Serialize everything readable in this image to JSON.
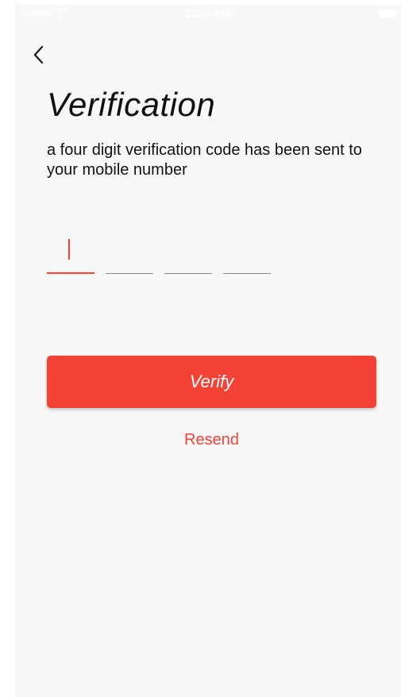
{
  "status_bar": {
    "carrier": "Carrier",
    "time": "12:16 AM",
    "wifi_icon": "wifi-icon",
    "battery_icon": "battery-icon"
  },
  "nav": {
    "back_icon": "chevron-left-icon"
  },
  "title": "Verification",
  "subtitle": "a four digit verification code has been sent to your mobile number",
  "code": {
    "digits": [
      "",
      "",
      "",
      ""
    ],
    "active_index": 0
  },
  "verify_button": {
    "label": "Verify"
  },
  "resend_link": {
    "label": "Resend"
  },
  "colors": {
    "accent": "#f44336",
    "background": "#f8f8f8",
    "text": "#111111"
  }
}
